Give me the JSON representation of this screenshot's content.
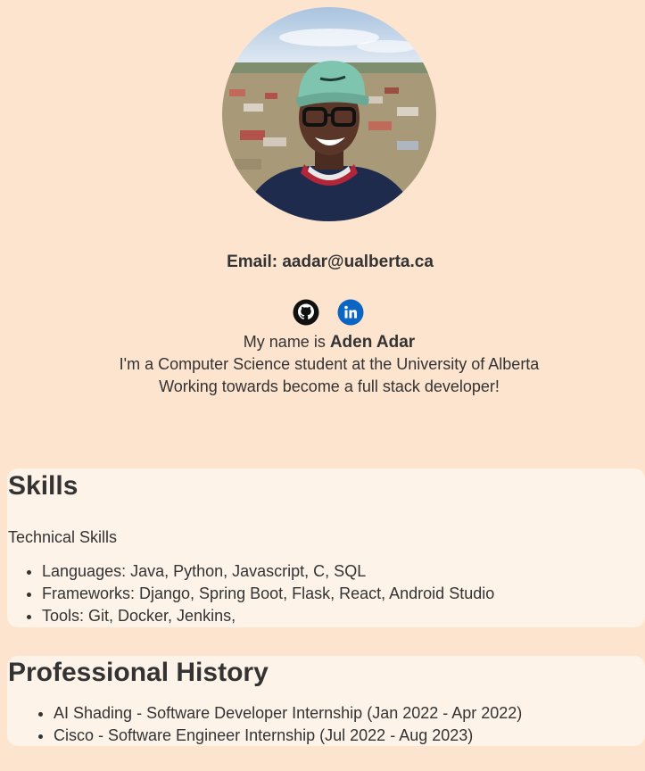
{
  "profile": {
    "photo_alt": "profile photo",
    "email": "Email: aadar@ualberta.ca"
  },
  "socials": {
    "github": "github-icon",
    "linkedin": "linkedin-icon"
  },
  "intro": {
    "name_prefix": "My name is ",
    "name": "Aden Adar",
    "line2": "I'm a Computer Science student at the University of Alberta",
    "line3": "Working towards become a full stack developer!"
  },
  "skills": {
    "title": "Skills",
    "subtitle": "Technical Skills",
    "items": [
      "Languages: Java, Python, Javascript, C, SQL",
      "Frameworks: Django, Spring Boot, Flask, React, Android Studio",
      "Tools: Git, Docker, Jenkins,"
    ]
  },
  "history": {
    "title": "Professional History",
    "items": [
      "AI Shading - Software Developer Internship (Jan 2022 - Apr 2022)",
      "Cisco - Software Engineer Internship (Jul 2022 - Aug 2023)"
    ]
  },
  "colors": {
    "background": "#fde4cf",
    "card": "#fef3e8",
    "text": "#333333",
    "linkedin": "#0a66c2"
  }
}
